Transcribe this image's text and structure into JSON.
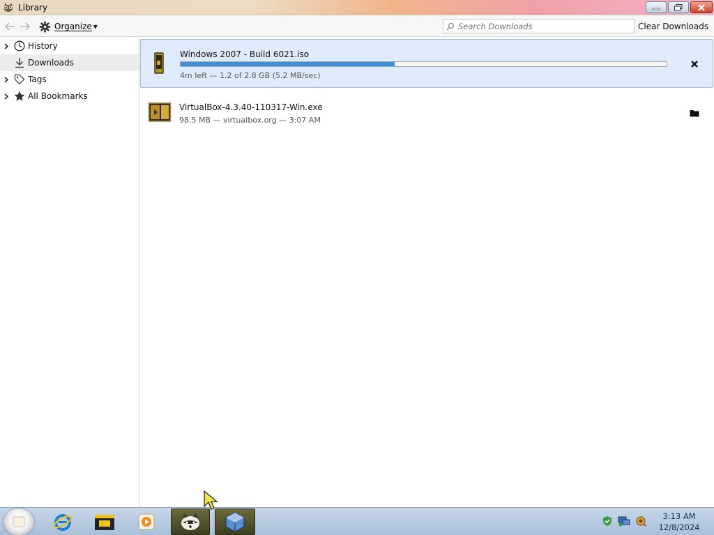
{
  "window": {
    "title": "Library",
    "minimize_icon": "minimize-icon",
    "restore_icon": "restore-icon",
    "close_icon": "close-icon"
  },
  "toolbar": {
    "back_icon": "back-arrow-icon",
    "forward_icon": "forward-arrow-icon",
    "organize_label": "Organize",
    "search_placeholder": "Search Downloads",
    "clear_label": "Clear Downloads"
  },
  "sidebar": {
    "items": [
      {
        "label": "History",
        "icon": "clock-icon",
        "expandable": true,
        "selected": false
      },
      {
        "label": "Downloads",
        "icon": "download-icon",
        "expandable": false,
        "selected": true
      },
      {
        "label": "Tags",
        "icon": "tag-icon",
        "expandable": true,
        "selected": false
      },
      {
        "label": "All Bookmarks",
        "icon": "star-icon",
        "expandable": true,
        "selected": false
      }
    ]
  },
  "downloads": [
    {
      "name": "Windows 2007 - Build 6021.iso",
      "status": "4m left — 1.2 of 2.8 GB (5.2 MB/sec)",
      "progress": 0.44,
      "action_icon": "cancel-x-icon",
      "icon": "iso-file-icon"
    },
    {
      "name": "VirtualBox-4.3.40-110317-Win.exe",
      "status": "98.5 MB — virtualbox.org — 3:07 AM",
      "action_icon": "open-folder-icon",
      "icon": "exe-file-icon"
    }
  ],
  "taskbar": {
    "time": "3:13 AM",
    "date": "12/8/2024"
  },
  "colors": {
    "progress_fill": "#3c8fdc",
    "active_item_bg": "#dfeafb",
    "selected_sidebar_bg": "#ececec"
  }
}
